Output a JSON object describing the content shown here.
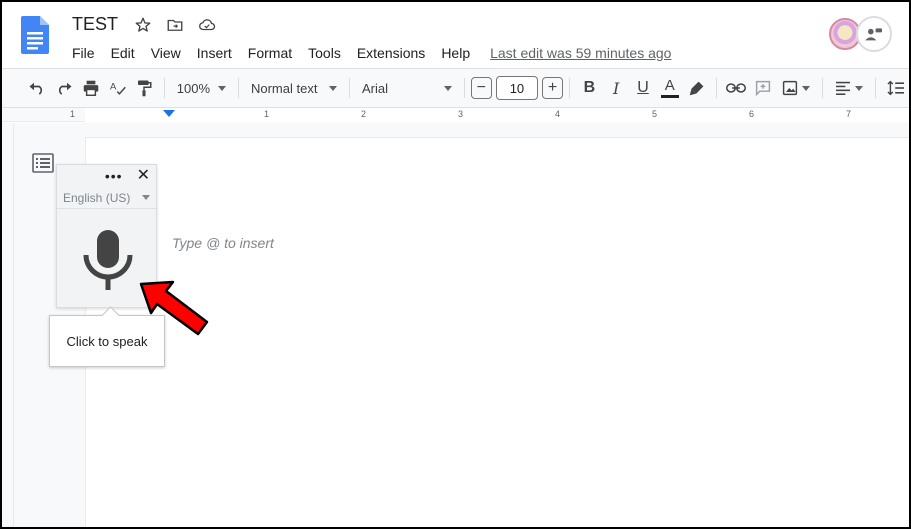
{
  "app": {
    "title": "TEST",
    "last_edit": "Last edit was 59 minutes ago"
  },
  "menu": [
    "File",
    "Edit",
    "View",
    "Insert",
    "Format",
    "Tools",
    "Extensions",
    "Help"
  ],
  "toolbar": {
    "zoom": "100%",
    "style": "Normal text",
    "font": "Arial",
    "font_size": "10",
    "minus": "−",
    "plus": "+",
    "bold": "B",
    "italic": "I",
    "underline": "U",
    "text_color": "A"
  },
  "ruler": {
    "numbers": [
      "1",
      "1",
      "2",
      "3",
      "4",
      "5",
      "6",
      "7"
    ]
  },
  "document": {
    "placeholder": "Type @ to insert"
  },
  "voice_typing": {
    "language": "English (US)",
    "dots": "•••",
    "close": "✕",
    "tooltip": "Click to speak"
  },
  "colors": {
    "accent": "#1a73e8",
    "arrow": "#ff0000",
    "doc_icon": "#4285f4"
  },
  "icons": [
    "docs-logo",
    "star-icon",
    "move-folder-icon",
    "cloud-saved-icon",
    "undo-icon",
    "redo-icon",
    "print-icon",
    "spellcheck-icon",
    "paint-format-icon",
    "highlight-icon",
    "link-icon",
    "comment-icon",
    "image-icon",
    "align-icon",
    "line-spacing-icon",
    "document-outline-icon",
    "microphone-icon",
    "annotation-arrow"
  ]
}
